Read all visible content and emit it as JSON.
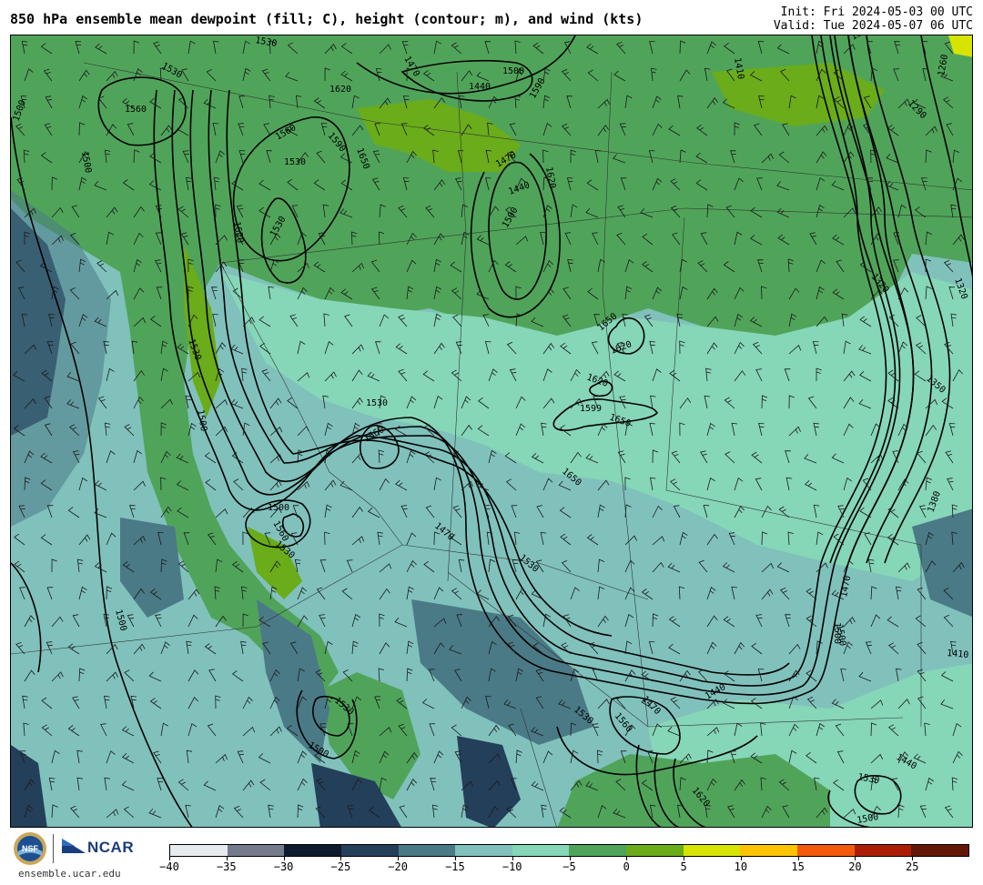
{
  "header": {
    "title": "850 hPa ensemble mean dewpoint (fill; C), height (contour; m), and wind (kts)",
    "init": "Init: Fri 2024-05-03 00 UTC",
    "valid": "Valid: Tue 2024-05-07 06 UTC"
  },
  "footer": {
    "site": "ensemble.ucar.edu",
    "ncar_label": "NCAR",
    "nsf_label": "NSF"
  },
  "colorbar": {
    "colors": [
      "#e6ebf0",
      "#747c8c",
      "#0e1a30",
      "#243f5a",
      "#4a7a86",
      "#80c1bc",
      "#86d6b8",
      "#50a45a",
      "#6aac1a",
      "#d6e400",
      "#fcc400",
      "#f35a0c",
      "#ac1d06",
      "#631706"
    ],
    "tick_labels": [
      "−40",
      "−35",
      "−30",
      "−25",
      "−20",
      "−15",
      "−10",
      "−5",
      "0",
      "5",
      "10",
      "15",
      "20",
      "25"
    ]
  },
  "map": {
    "contour_labels": [
      {
        "text": "1530"
      },
      {
        "text": "1560"
      },
      {
        "text": "1500"
      },
      {
        "text": "1500"
      },
      {
        "text": "1530"
      },
      {
        "text": "1560"
      },
      {
        "text": "1530"
      },
      {
        "text": "1590"
      },
      {
        "text": "1650"
      },
      {
        "text": "1530"
      },
      {
        "text": "1620"
      },
      {
        "text": "1620"
      },
      {
        "text": "1470"
      },
      {
        "text": "1440"
      },
      {
        "text": "1500"
      },
      {
        "text": "1590"
      },
      {
        "text": "1410"
      },
      {
        "text": "1470"
      },
      {
        "text": "1440"
      },
      {
        "text": "1500"
      },
      {
        "text": "1620"
      },
      {
        "text": "1650"
      },
      {
        "text": "1620"
      },
      {
        "text": "1620"
      },
      {
        "text": "1599"
      },
      {
        "text": "1650"
      },
      {
        "text": "1530"
      },
      {
        "text": "1560"
      },
      {
        "text": "1500"
      },
      {
        "text": "1530"
      },
      {
        "text": "1650"
      },
      {
        "text": "1470"
      },
      {
        "text": "1500"
      },
      {
        "text": "1530"
      },
      {
        "text": "1560"
      },
      {
        "text": "1530"
      },
      {
        "text": "1500"
      },
      {
        "text": "1500"
      },
      {
        "text": "1500"
      },
      {
        "text": "1530"
      },
      {
        "text": "1620"
      },
      {
        "text": "1440"
      },
      {
        "text": "1470"
      },
      {
        "text": "1560"
      },
      {
        "text": "1530"
      },
      {
        "text": "1350"
      },
      {
        "text": "1290"
      },
      {
        "text": "1260"
      },
      {
        "text": "1320"
      },
      {
        "text": "1320"
      },
      {
        "text": "1350"
      },
      {
        "text": "1380"
      },
      {
        "text": "1470"
      },
      {
        "text": "1500"
      },
      {
        "text": "1410"
      },
      {
        "text": "1440"
      },
      {
        "text": "1530"
      },
      {
        "text": "1500"
      }
    ]
  }
}
